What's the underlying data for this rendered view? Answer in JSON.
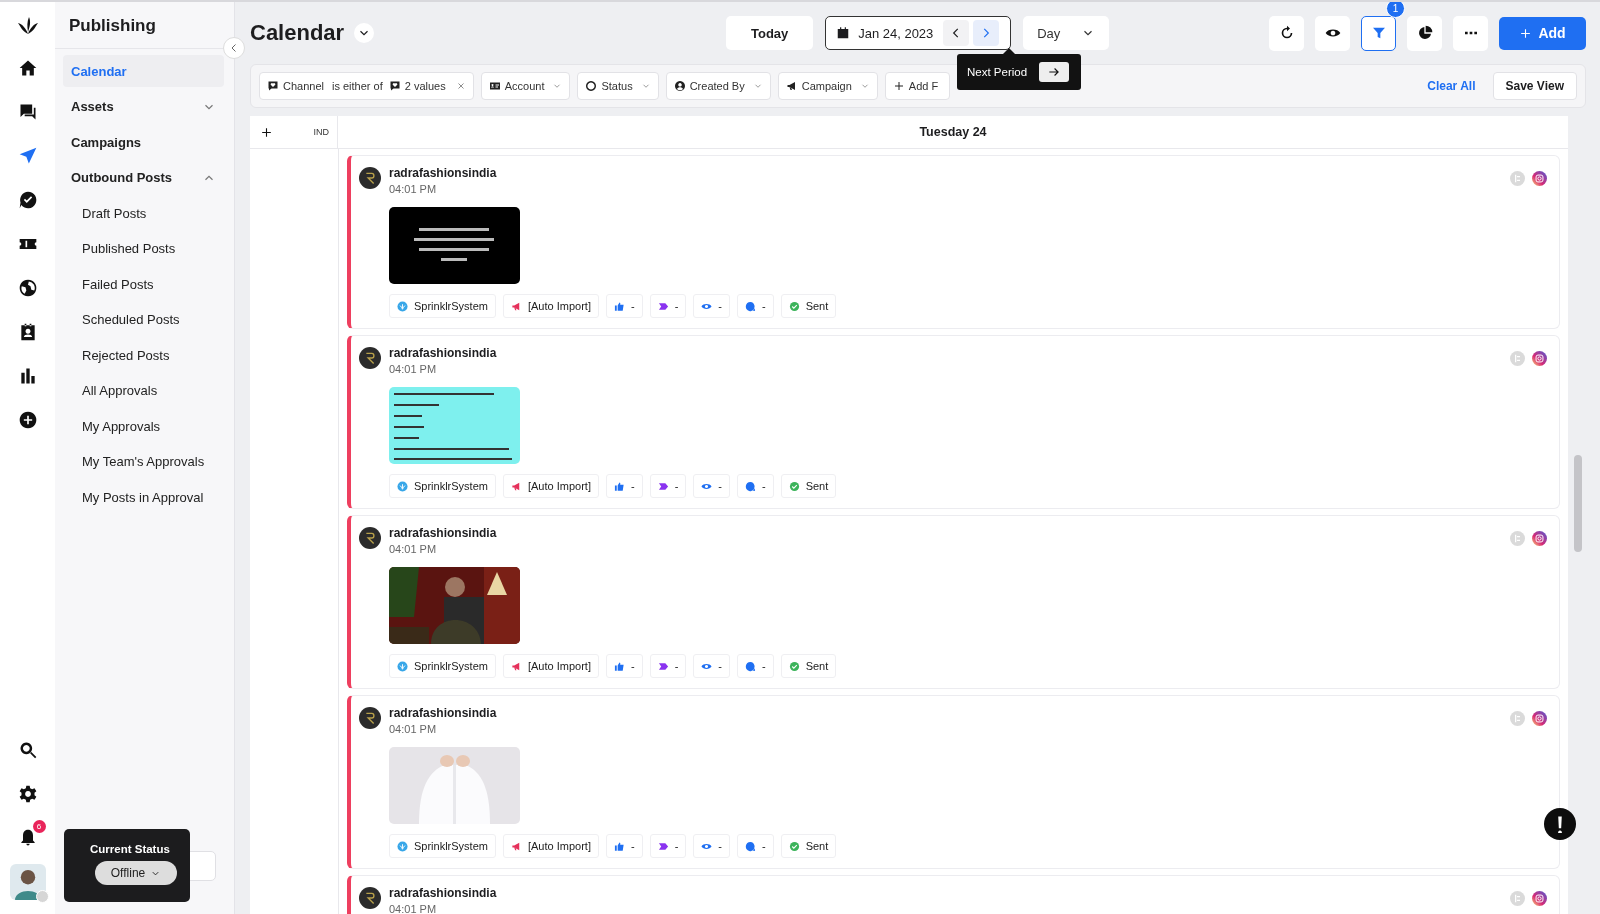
{
  "rail": [
    {
      "kind": "home",
      "selected": false
    },
    {
      "kind": "chat",
      "selected": false
    },
    {
      "kind": "send",
      "selected": true
    },
    {
      "kind": "approve",
      "selected": false
    },
    {
      "kind": "ticket",
      "selected": false
    },
    {
      "kind": "globe",
      "selected": false
    },
    {
      "kind": "contact",
      "selected": false
    },
    {
      "kind": "chart",
      "selected": false
    },
    {
      "kind": "plus",
      "selected": false
    }
  ],
  "rail_bottom": [
    {
      "kind": "search"
    },
    {
      "kind": "settings"
    },
    {
      "kind": "bell",
      "badge": "6"
    },
    {
      "kind": "avatar"
    }
  ],
  "sidebar": {
    "title": "Publishing",
    "items": [
      {
        "label": "Calendar",
        "selected": true
      },
      {
        "label": "Assets",
        "selected": false,
        "expanded": false
      },
      {
        "label": "Campaigns",
        "selected": false
      },
      {
        "label": "Outbound Posts",
        "selected": false,
        "expanded": true,
        "children": [
          {
            "label": "Draft Posts",
            "selected": false
          },
          {
            "label": "Published Posts",
            "selected": false
          },
          {
            "label": "Failed Posts",
            "selected": false
          },
          {
            "label": "Scheduled Posts",
            "selected": false
          },
          {
            "label": "Rejected Posts",
            "selected": false
          },
          {
            "label": "All Approvals",
            "selected": false
          },
          {
            "label": "My Approvals",
            "selected": false
          },
          {
            "label": "My Team's Approvals",
            "selected": false
          },
          {
            "label": "My Posts in Approval",
            "selected": false
          }
        ]
      }
    ]
  },
  "current_status": {
    "title": "Current Status",
    "value": "Offline"
  },
  "header": {
    "title": "Calendar",
    "today": "Today",
    "date": "Jan 24, 2023",
    "view": "Day",
    "filter_badge": "1",
    "add": "Add"
  },
  "tooltip": {
    "text": "Next Period"
  },
  "filters": [
    {
      "kind": "channel",
      "label": "Channel",
      "operator": "is either of",
      "value": "2 values"
    },
    {
      "kind": "account",
      "label": "Account"
    },
    {
      "kind": "status",
      "label": "Status"
    },
    {
      "kind": "creator",
      "label": "Created By"
    },
    {
      "kind": "campaign",
      "label": "Campaign"
    },
    {
      "kind": "add",
      "label": "Add F"
    }
  ],
  "clear_all": "Clear All",
  "save_view": "Save View",
  "calendar": {
    "timezone": "IND",
    "day": "Tuesday 24",
    "posts": [
      {
        "account": "radrafashionsindia",
        "time": "04:01 PM",
        "chips": [
          {
            "kind": "user",
            "text": "SprinklrSystem"
          },
          {
            "kind": "campaign",
            "text": "[Auto Import]"
          },
          {
            "kind": "likes",
            "text": "-"
          },
          {
            "kind": "tags",
            "text": "-"
          },
          {
            "kind": "views",
            "text": "-"
          },
          {
            "kind": "comments",
            "text": "-"
          },
          {
            "kind": "status",
            "text": "Sent"
          }
        ]
      },
      {
        "account": "radrafashionsindia",
        "time": "04:01 PM",
        "chips": [
          {
            "kind": "user",
            "text": "SprinklrSystem"
          },
          {
            "kind": "campaign",
            "text": "[Auto Import]"
          },
          {
            "kind": "likes",
            "text": "-"
          },
          {
            "kind": "tags",
            "text": "-"
          },
          {
            "kind": "views",
            "text": "-"
          },
          {
            "kind": "comments",
            "text": "-"
          },
          {
            "kind": "status",
            "text": "Sent"
          }
        ]
      },
      {
        "account": "radrafashionsindia",
        "time": "04:01 PM",
        "chips": [
          {
            "kind": "user",
            "text": "SprinklrSystem"
          },
          {
            "kind": "campaign",
            "text": "[Auto Import]"
          },
          {
            "kind": "likes",
            "text": "-"
          },
          {
            "kind": "tags",
            "text": "-"
          },
          {
            "kind": "views",
            "text": "-"
          },
          {
            "kind": "comments",
            "text": "-"
          },
          {
            "kind": "status",
            "text": "Sent"
          }
        ]
      },
      {
        "account": "radrafashionsindia",
        "time": "04:01 PM",
        "chips": [
          {
            "kind": "user",
            "text": "SprinklrSystem"
          },
          {
            "kind": "campaign",
            "text": "[Auto Import]"
          },
          {
            "kind": "likes",
            "text": "-"
          },
          {
            "kind": "tags",
            "text": "-"
          },
          {
            "kind": "views",
            "text": "-"
          },
          {
            "kind": "comments",
            "text": "-"
          },
          {
            "kind": "status",
            "text": "Sent"
          }
        ]
      },
      {
        "account": "radrafashionsindia",
        "time": "04:01 PM"
      }
    ]
  }
}
